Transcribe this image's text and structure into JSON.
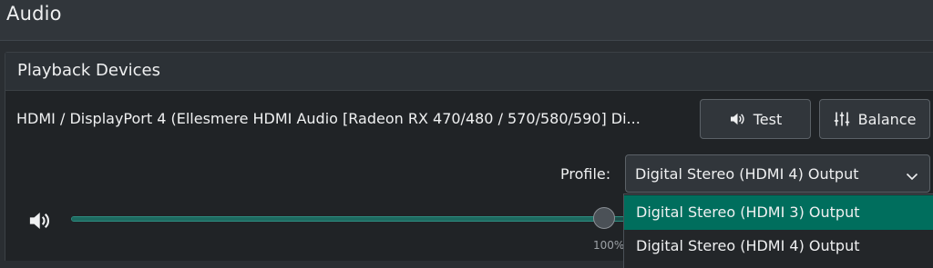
{
  "page": {
    "title": "Audio"
  },
  "section": {
    "title": "Playback Devices"
  },
  "device": {
    "name": "HDMI / DisplayPort 4 (Ellesmere HDMI Audio [Radeon RX 470/480 / 570/580/590] Di...",
    "test_label": "Test",
    "test_icon": "speaker-icon",
    "balance_label": "Balance",
    "balance_icon": "sliders-icon"
  },
  "profile": {
    "label": "Profile:",
    "selected": "Digital Stereo (HDMI 4) Output",
    "options": [
      {
        "label": "Digital Stereo (HDMI 3) Output",
        "highlighted": true
      },
      {
        "label": "Digital Stereo (HDMI 4) Output",
        "highlighted": false
      }
    ]
  },
  "volume": {
    "icon": "speaker-icon",
    "value_percent": 100,
    "label": "100%"
  },
  "colors": {
    "accent": "#006e5d",
    "background": "#202326",
    "header": "#31363b"
  }
}
